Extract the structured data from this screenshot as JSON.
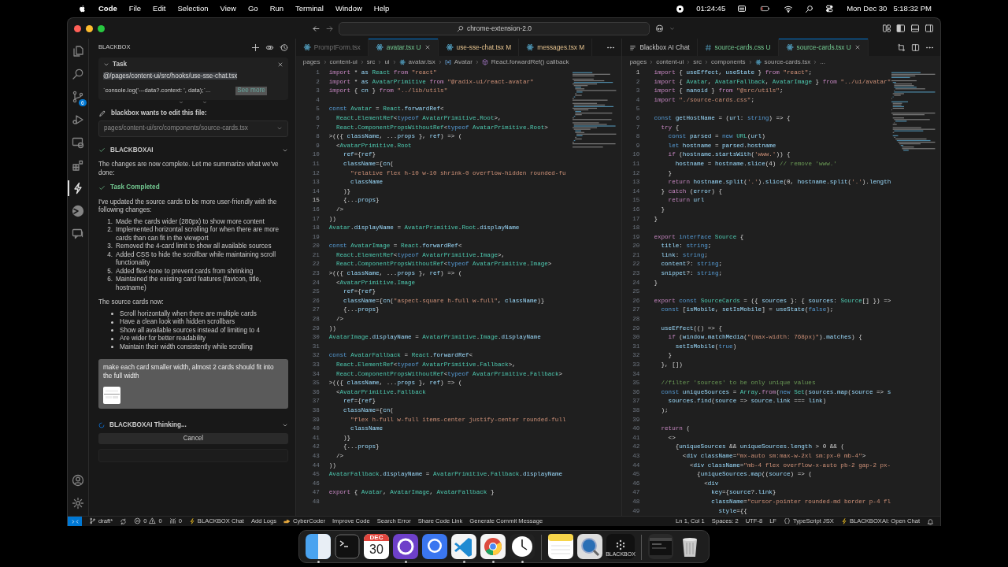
{
  "menu_bar": {
    "app": "Code",
    "items": [
      "File",
      "Edit",
      "Selection",
      "View",
      "Go",
      "Run",
      "Terminal",
      "Window",
      "Help"
    ],
    "recording_time": "01:24:45",
    "date": "Mon Dec 30",
    "time": "5:18:32 PM"
  },
  "title_bar": {
    "search": "chrome-extension-2.0"
  },
  "activity_bar": {
    "items": [
      {
        "kind": "explorer",
        "selected": false
      },
      {
        "kind": "search",
        "selected": false
      },
      {
        "kind": "source-control",
        "selected": false,
        "badge": "6"
      },
      {
        "kind": "run",
        "selected": false
      },
      {
        "kind": "remote",
        "selected": false
      },
      {
        "kind": "extensions",
        "selected": false
      },
      {
        "kind": "bolt",
        "selected": true
      },
      {
        "kind": "pie",
        "selected": false
      },
      {
        "kind": "chat",
        "selected": false
      }
    ],
    "bottom": [
      {
        "kind": "account"
      },
      {
        "kind": "settings"
      }
    ]
  },
  "sidebar": {
    "title": "BLACKBOX",
    "task": {
      "title": "Task",
      "file": "@/pages/content-ui/src/hooks/use-sse-chat.tsx",
      "snippet": "`console.log('---data?.context: ', data);`...",
      "see_more": "See more"
    },
    "edit_request": {
      "label": "blackbox wants to edit this file:",
      "file": "pages/content-ui/src/components/source-cards.tsx"
    },
    "blocks": [
      {
        "kind": "header",
        "text": "BLACKBOXAI"
      },
      {
        "kind": "paragraph",
        "text": "The changes are now complete. Let me summarize what we've done:"
      },
      {
        "kind": "success",
        "text": "Task Completed"
      },
      {
        "kind": "paragraph",
        "text": "I've updated the source cards to be more user-friendly with the following changes:"
      },
      {
        "kind": "ordered",
        "items": [
          {
            "number": "1.",
            "text": "Made the cards wider (280px) to show more content"
          },
          {
            "number": "2.",
            "text": "Implemented horizontal scrolling for when there are more cards than can fit in the viewport"
          },
          {
            "number": "3.",
            "text": "Removed the 4-card limit to show all available sources"
          },
          {
            "number": "4.",
            "text": "Added CSS to hide the scrollbar while maintaining scroll functionality"
          },
          {
            "number": "5.",
            "text": "Added flex-none to prevent cards from shrinking"
          },
          {
            "number": "6.",
            "text": "Maintained the existing card features (favicon, title, hostname)"
          }
        ]
      },
      {
        "kind": "paragraph",
        "text": "The source cards now:"
      },
      {
        "kind": "bullets",
        "items": [
          "Scroll horizontally when there are multiple cards",
          "Have a clean look with hidden scrollbars",
          "Show all available sources instead of limiting to 4",
          "Are wider for better readability",
          "Maintain their width consistently while scrolling"
        ]
      }
    ],
    "user_message": {
      "text": "make each card smaller width, almost 2 cards should fit into the full width"
    },
    "thinking": "BLACKBOXAI Thinking...",
    "cancel": "Cancel"
  },
  "editor_groups": [
    {
      "tabs": [
        {
          "kind": "tsx",
          "label": "PromptForm.tsx",
          "dimmed": true,
          "selected": false
        },
        {
          "kind": "tsx",
          "label": "avatar.tsx",
          "badge": "U",
          "dimmed": false,
          "selected": true
        },
        {
          "kind": "tsx",
          "label": "use-sse-chat.tsx",
          "badge": "M",
          "dimmed": false,
          "selected": false
        },
        {
          "kind": "tsx",
          "label": "messages.tsx",
          "badge": "M",
          "dimmed": false,
          "selected": false
        }
      ],
      "breadcrumbs": [
        {
          "kind": "folder",
          "text": "pages"
        },
        {
          "kind": "folder",
          "text": "content-ui"
        },
        {
          "kind": "folder",
          "text": "src"
        },
        {
          "kind": "folder",
          "text": "ui"
        },
        {
          "kind": "tsx",
          "text": "avatar.tsx"
        },
        {
          "kind": "variable",
          "text": "Avatar"
        },
        {
          "kind": "method",
          "text": "React.forwardRef() callback"
        }
      ],
      "lines": [
        [
          "1",
          false,
          "import * as React from \"react\""
        ],
        [
          "2",
          false,
          "import * as AvatarPrimitive from \"@radix-ui/react-avatar\""
        ],
        [
          "3",
          false,
          "import { cn } from \"../lib/utils\""
        ],
        [
          "4",
          false
        ],
        [
          "5",
          false,
          "const Avatar = React.forwardRef<"
        ],
        [
          "6",
          false,
          "  React.ElementRef<typeof AvatarPrimitive.Root>,"
        ],
        [
          "7",
          false,
          "  React.ComponentPropsWithoutRef<typeof AvatarPrimitive.Root>"
        ],
        [
          "8",
          false,
          ">(({ className, ...props }, ref) => ("
        ],
        [
          "9",
          false,
          "  <AvatarPrimitive.Root"
        ],
        [
          "10",
          false,
          "    ref={ref}"
        ],
        [
          "11",
          false,
          "    className={cn("
        ],
        [
          "12",
          false,
          "      \"relative flex h-10 w-10 shrink-0 overflow-hidden rounded-fu"
        ],
        [
          "13",
          false,
          "      className"
        ],
        [
          "14",
          false,
          "    )}"
        ],
        [
          "15",
          true,
          "    {...props}"
        ],
        [
          "16",
          false,
          "  />"
        ],
        [
          "17",
          false,
          "))"
        ],
        [
          "18",
          false,
          "Avatar.displayName = AvatarPrimitive.Root.displayName"
        ],
        [
          "19",
          false
        ],
        [
          "20",
          false,
          "const AvatarImage = React.forwardRef<"
        ],
        [
          "21",
          false,
          "  React.ElementRef<typeof AvatarPrimitive.Image>,"
        ],
        [
          "22",
          false,
          "  React.ComponentPropsWithoutRef<typeof AvatarPrimitive.Image>"
        ],
        [
          "23",
          false,
          ">(({ className, ...props }, ref) => ("
        ],
        [
          "24",
          false,
          "  <AvatarPrimitive.Image"
        ],
        [
          "25",
          false,
          "    ref={ref}"
        ],
        [
          "26",
          false,
          "    className={cn(\"aspect-square h-full w-full\", className)}"
        ],
        [
          "27",
          false,
          "    {...props}"
        ],
        [
          "28",
          false,
          "  />"
        ],
        [
          "29",
          false,
          "))"
        ],
        [
          "30",
          false,
          "AvatarImage.displayName = AvatarPrimitive.Image.displayName"
        ],
        [
          "31",
          false
        ],
        [
          "32",
          false,
          "const AvatarFallback = React.forwardRef<"
        ],
        [
          "33",
          false,
          "  React.ElementRef<typeof AvatarPrimitive.Fallback>,"
        ],
        [
          "34",
          false,
          "  React.ComponentPropsWithoutRef<typeof AvatarPrimitive.Fallback>"
        ],
        [
          "35",
          false,
          ">(({ className, ...props }, ref) => ("
        ],
        [
          "36",
          false,
          "  <AvatarPrimitive.Fallback"
        ],
        [
          "37",
          false,
          "    ref={ref}"
        ],
        [
          "38",
          false,
          "    className={cn("
        ],
        [
          "39",
          false,
          "      \"flex h-full w-full items-center justify-center rounded-full"
        ],
        [
          "40",
          false,
          "      className"
        ],
        [
          "41",
          false,
          "    )}"
        ],
        [
          "42",
          false,
          "    {...props}"
        ],
        [
          "43",
          false,
          "  />"
        ],
        [
          "44",
          false,
          "))"
        ],
        [
          "45",
          false,
          "AvatarFallback.displayName = AvatarPrimitive.Fallback.displayName"
        ],
        [
          "46",
          false
        ],
        [
          "47",
          false,
          "export { Avatar, AvatarImage, AvatarFallback }"
        ],
        [
          "48",
          false
        ]
      ]
    },
    {
      "tabs": [
        {
          "kind": "chat",
          "label": "Blackbox AI Chat",
          "dimmed": false,
          "selected": false
        },
        {
          "kind": "css",
          "label": "source-cards.css",
          "badge": "U",
          "dimmed": false,
          "selected": false
        },
        {
          "kind": "tsx",
          "label": "source-cards.tsx",
          "badge": "U",
          "dimmed": false,
          "selected": true
        }
      ],
      "breadcrumbs": [
        {
          "kind": "folder",
          "text": "pages"
        },
        {
          "kind": "folder",
          "text": "content-ui"
        },
        {
          "kind": "folder",
          "text": "src"
        },
        {
          "kind": "folder",
          "text": "components"
        },
        {
          "kind": "tsx",
          "text": "source-cards.tsx"
        },
        {
          "kind": "folder",
          "text": "..."
        }
      ],
      "lines": [
        [
          "1",
          true,
          "import { useEffect, useState } from \"react\";"
        ],
        [
          "2",
          false,
          "import { Avatar, AvatarFallback, AvatarImage } from \"../ui/avatar\""
        ],
        [
          "3",
          false,
          "import { nanoid } from \"@src/utils\";"
        ],
        [
          "4",
          false,
          "import \"./source-cards.css\";"
        ],
        [
          "5",
          false
        ],
        [
          "6",
          false,
          "const getHostName = (url: string) => {"
        ],
        [
          "7",
          false,
          "  try {"
        ],
        [
          "8",
          false,
          "    const parsed = new URL(url)"
        ],
        [
          "9",
          false,
          "    let hostname = parsed.hostname"
        ],
        [
          "10",
          false,
          "    if (hostname.startsWith('www.')) {"
        ],
        [
          "11",
          false,
          "      hostname = hostname.slice(4) // remove 'www.'"
        ],
        [
          "12",
          false,
          "    }"
        ],
        [
          "13",
          false,
          "    return hostname.split('.').slice(0, hostname.split('.').length"
        ],
        [
          "14",
          false,
          "  } catch (error) {"
        ],
        [
          "15",
          false,
          "    return url"
        ],
        [
          "16",
          false,
          "  }"
        ],
        [
          "17",
          false,
          "}"
        ],
        [
          "18",
          false
        ],
        [
          "19",
          false,
          "export interface Source {"
        ],
        [
          "20",
          false,
          "  title: string;"
        ],
        [
          "21",
          false,
          "  link: string;"
        ],
        [
          "22",
          false,
          "  content?: string;"
        ],
        [
          "23",
          false,
          "  snippet?: string;"
        ],
        [
          "24",
          false,
          "}"
        ],
        [
          "25",
          false
        ],
        [
          "26",
          false,
          "export const SourceCards = ({ sources }: { sources: Source[] }) =>"
        ],
        [
          "27",
          false,
          "  const [isMobile, setIsMobile] = useState(false);"
        ],
        [
          "28",
          false
        ],
        [
          "29",
          false,
          "  useEffect(() => {"
        ],
        [
          "30",
          false,
          "    if (window.matchMedia(\"(max-width: 768px)\").matches) {"
        ],
        [
          "31",
          false,
          "      setIsMobile(true)"
        ],
        [
          "32",
          false,
          "    }"
        ],
        [
          "33",
          false,
          "  }, [])"
        ],
        [
          "34",
          false
        ],
        [
          "35",
          false,
          "  //filter 'sources' to be only unique values"
        ],
        [
          "36",
          false,
          "  const uniqueSources = Array.from(new Set(sources.map(source => s"
        ],
        [
          "37",
          false,
          "    sources.find(source => source.link === link)"
        ],
        [
          "38",
          false,
          "  );"
        ],
        [
          "39",
          false
        ],
        [
          "40",
          false,
          "  return ("
        ],
        [
          "41",
          false,
          "    <>"
        ],
        [
          "42",
          false,
          "      {uniqueSources && uniqueSources.length > 0 && ("
        ],
        [
          "43",
          false,
          "        <div className=\"mx-auto sm:max-w-2xl sm:px-0 mb-4\">"
        ],
        [
          "44",
          false,
          "          <div className=\"mb-4 flex overflow-x-auto pb-2 gap-2 px-"
        ],
        [
          "45",
          false,
          "            {uniqueSources.map((source) => ("
        ],
        [
          "46",
          false,
          "              <div"
        ],
        [
          "47",
          false,
          "                key={source?.link}"
        ],
        [
          "48",
          false,
          "                className=\"cursor-pointer rounded-md border p-4 fl"
        ],
        [
          "49",
          false,
          "                  style={{"
        ]
      ]
    }
  ],
  "status_bar": {
    "branch": "draft*",
    "errors": "0",
    "warnings": "0",
    "ports": "0",
    "left_items": [
      {
        "kind": "bolt",
        "label": "BLACKBOX Chat"
      },
      {
        "kind": "plain",
        "label": "Add Logs"
      },
      {
        "kind": "hand",
        "label": "CyberCoder"
      },
      {
        "kind": "plain",
        "label": "Improve Code"
      },
      {
        "kind": "plain",
        "label": "Search Error"
      },
      {
        "kind": "plain",
        "label": "Share Code Link"
      },
      {
        "kind": "plain",
        "label": "Generate Commit Message"
      }
    ],
    "right_items": [
      {
        "kind": "plain",
        "label": "Ln 1, Col 1"
      },
      {
        "kind": "plain",
        "label": "Spaces: 2"
      },
      {
        "kind": "plain",
        "label": "UTF-8"
      },
      {
        "kind": "plain",
        "label": "LF"
      },
      {
        "kind": "braces",
        "label": "TypeScript JSX"
      },
      {
        "kind": "bolt",
        "label": "BLACKBOXAI: Open Chat"
      }
    ]
  },
  "dock": {
    "items": [
      {
        "kind": "finder",
        "running": true
      },
      {
        "kind": "terminal",
        "running": false
      },
      {
        "kind": "calendar",
        "month": "DEC",
        "day": "30",
        "running": false
      },
      {
        "kind": "github",
        "running": true
      },
      {
        "kind": "signal",
        "running": false
      },
      {
        "kind": "vscode",
        "running": true
      },
      {
        "kind": "chrome",
        "running": true
      },
      {
        "kind": "clock",
        "running": true
      },
      {
        "kind": "separator"
      },
      {
        "kind": "notes",
        "running": false
      },
      {
        "kind": "quicktime",
        "running": false
      },
      {
        "kind": "blackbox",
        "label": "BLACKBOX",
        "running": false
      },
      {
        "kind": "separator"
      },
      {
        "kind": "thumbnail",
        "running": false
      },
      {
        "kind": "trash",
        "running": false
      }
    ]
  }
}
